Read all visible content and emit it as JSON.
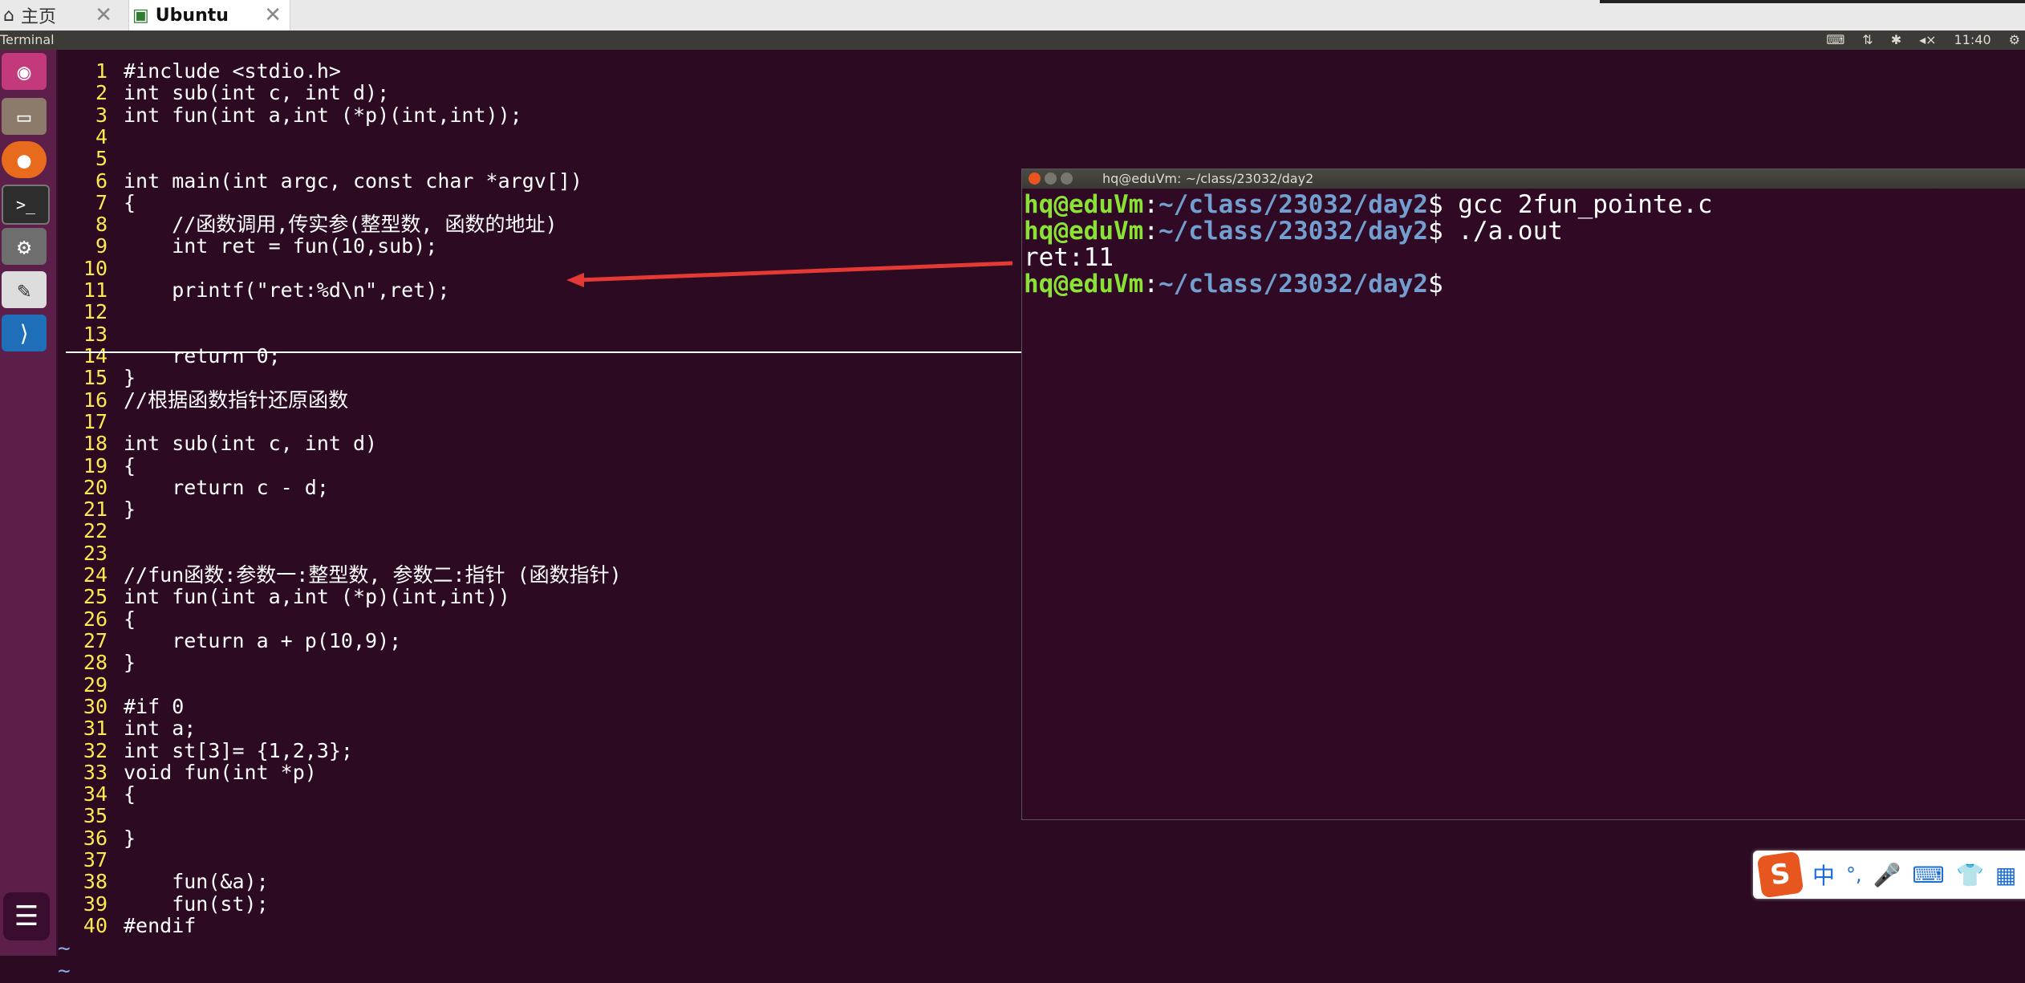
{
  "host_tabs": {
    "home_label": "主页",
    "ubuntu_label": "Ubuntu",
    "close_glyph": "✕"
  },
  "panel": {
    "title": "Terminal",
    "time": "11:40"
  },
  "editor": {
    "lines": [
      {
        "n": "1",
        "text": "#include <stdio.h>"
      },
      {
        "n": "2",
        "text": "int sub(int c, int d);"
      },
      {
        "n": "3",
        "text": "int fun(int a,int (*p)(int,int));"
      },
      {
        "n": "4",
        "text": ""
      },
      {
        "n": "5",
        "text": ""
      },
      {
        "n": "6",
        "text": "int main(int argc, const char *argv[])"
      },
      {
        "n": "7",
        "text": "{"
      },
      {
        "n": "8",
        "text": "    //函数调用,传实参(整型数, 函数的地址)"
      },
      {
        "n": "9",
        "text": "    int ret = fun(10,sub);"
      },
      {
        "n": "10",
        "text": ""
      },
      {
        "n": "11",
        "text": "    printf(\"ret:%d\\n\",ret);"
      },
      {
        "n": "12",
        "text": ""
      },
      {
        "n": "13",
        "text": ""
      },
      {
        "n": "14",
        "text": "    return 0;"
      },
      {
        "n": "15",
        "text": "}"
      },
      {
        "n": "16",
        "text": "//根据函数指针还原函数"
      },
      {
        "n": "17",
        "text": ""
      },
      {
        "n": "18",
        "text": "int sub(int c, int d)"
      },
      {
        "n": "19",
        "text": "{"
      },
      {
        "n": "20",
        "text": "    return c - d;"
      },
      {
        "n": "21",
        "text": "}"
      },
      {
        "n": "22",
        "text": ""
      },
      {
        "n": "23",
        "text": ""
      },
      {
        "n": "24",
        "text": "//fun函数:参数一:整型数, 参数二:指针 (函数指针)"
      },
      {
        "n": "25",
        "text": "int fun(int a,int (*p)(int,int))"
      },
      {
        "n": "26",
        "text": "{"
      },
      {
        "n": "27",
        "text": "    return a + p(10,9);"
      },
      {
        "n": "28",
        "text": "}"
      },
      {
        "n": "29",
        "text": ""
      },
      {
        "n": "30",
        "text": "#if 0"
      },
      {
        "n": "31",
        "text": "int a;"
      },
      {
        "n": "32",
        "text": "int st[3]= {1,2,3};"
      },
      {
        "n": "33",
        "text": "void fun(int *p)"
      },
      {
        "n": "34",
        "text": "{"
      },
      {
        "n": "35",
        "text": ""
      },
      {
        "n": "36",
        "text": "}"
      },
      {
        "n": "37",
        "text": ""
      },
      {
        "n": "38",
        "text": "    fun(&a);"
      },
      {
        "n": "39",
        "text": "    fun(st);"
      },
      {
        "n": "40",
        "text": "#endif"
      }
    ],
    "tilde": "~"
  },
  "terminal": {
    "title": "hq@eduVm: ~/class/23032/day2",
    "prompt_user": "hq@eduVm",
    "prompt_colon": ":",
    "prompt_path": "~/class/23032/day2",
    "prompt_symbol": "$",
    "lines": [
      {
        "type": "cmd",
        "command": " gcc 2fun_pointe.c"
      },
      {
        "type": "cmd",
        "command": " ./a.out"
      },
      {
        "type": "out",
        "text": "ret:11"
      },
      {
        "type": "cmd",
        "command": ""
      }
    ]
  },
  "ime": {
    "logo": "S",
    "mode": "中",
    "punct": "°,"
  },
  "colors": {
    "terminal_bg": "#300a24",
    "line_number": "#fce94f",
    "prompt_user": "#8ae234",
    "prompt_path": "#729fcf",
    "arrow": "#e53935"
  }
}
